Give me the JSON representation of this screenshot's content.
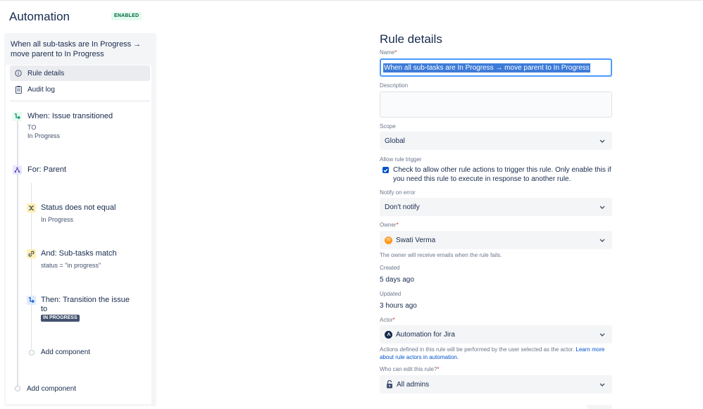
{
  "header": {
    "app_title": "Automation",
    "status_badge": "ENABLED"
  },
  "sidebar": {
    "rule_name": "When all sub-tasks are In Progress → move parent to In Progress",
    "nav": [
      {
        "label": "Rule details",
        "icon": "info-icon"
      },
      {
        "label": "Audit log",
        "icon": "clipboard-icon"
      }
    ],
    "components": {
      "trigger": {
        "title": "When: Issue transitioned",
        "line1": "To",
        "line2": "In Progress",
        "icon": "trigger-icon"
      },
      "branch": {
        "title": "For: Parent",
        "icon": "branch-icon"
      },
      "condition1": {
        "title": "Status does not equal",
        "sub": "In Progress",
        "icon": "shuffle-icon"
      },
      "condition2": {
        "title": "And: Sub-tasks match",
        "sub": "status = \"in progress\"",
        "icon": "link-icon"
      },
      "action": {
        "title": "Then: Transition the issue",
        "title2": "to",
        "lozenge": "IN PROGRESS",
        "icon": "transition-icon"
      },
      "add_inner": "Add component",
      "add_outer": "Add component"
    }
  },
  "form": {
    "title": "Rule details",
    "name_label": "Name",
    "name_value": "When all sub-tasks are In Progress → move parent to In Progress",
    "description_label": "Description",
    "description_value": "",
    "scope_label": "Scope",
    "scope_value": "Global",
    "allow_trigger_label": "Allow rule trigger",
    "allow_trigger_text": "Check to allow other rule actions to trigger this rule. Only enable this if you need this rule to execute in response to another rule.",
    "allow_trigger_checked": true,
    "notify_label": "Notify on error",
    "notify_value": "Don't notify",
    "owner_label": "Owner",
    "owner_value": "Swati Verma",
    "owner_initial": "W",
    "owner_helper": "The owner will receive emails when the rule fails.",
    "created_label": "Created",
    "created_value": "5 days ago",
    "updated_label": "Updated",
    "updated_value": "3 hours ago",
    "actor_label": "Actor",
    "actor_value": "Automation for Jira",
    "actor_helper": "Actions defined in this rule will be performed by the user selected as the actor.",
    "actor_link": "Learn more about rule actors in automation.",
    "editors_label": "Who can edit this rule?",
    "editors_value": "All admins",
    "required_mark": "*"
  },
  "colors": {
    "accent": "#0052cc",
    "focus_border": "#4c9aff",
    "badge_bg": "#e3fcef",
    "badge_text": "#006644",
    "lozenge_bg": "#42526e"
  }
}
